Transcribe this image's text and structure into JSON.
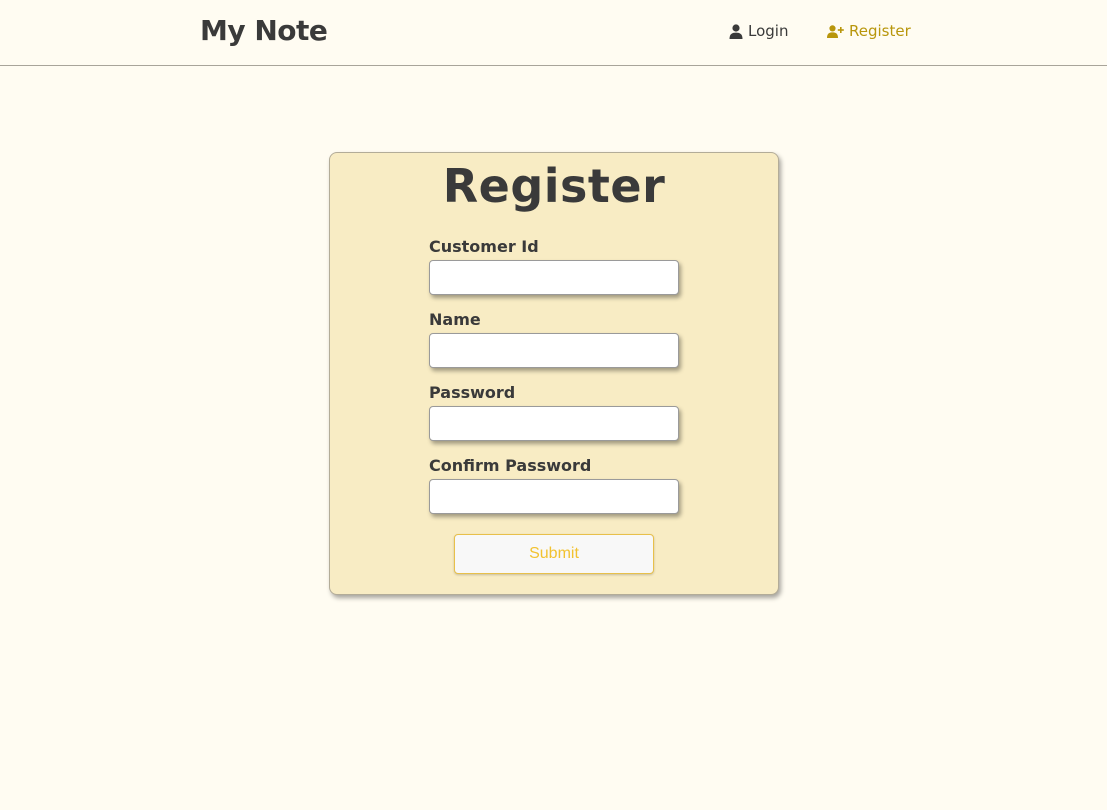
{
  "navbar": {
    "brand": "My Note",
    "links": [
      {
        "label": "Login",
        "icon": "user-icon",
        "color": "#3a3a3a"
      },
      {
        "label": "Register",
        "icon": "user-plus-icon",
        "color": "#b8960c",
        "active": true
      }
    ]
  },
  "form": {
    "title": "Register",
    "fields": [
      {
        "label": "Customer Id",
        "value": "",
        "type": "text"
      },
      {
        "label": "Name",
        "value": "",
        "type": "text"
      },
      {
        "label": "Password",
        "value": "",
        "type": "password"
      },
      {
        "label": "Confirm Password",
        "value": "",
        "type": "password"
      }
    ],
    "submit_label": "Submit"
  },
  "colors": {
    "background": "#fffcf2",
    "card": "#f8ecc4",
    "accent": "#b8960c",
    "button_text": "#f2c230"
  }
}
